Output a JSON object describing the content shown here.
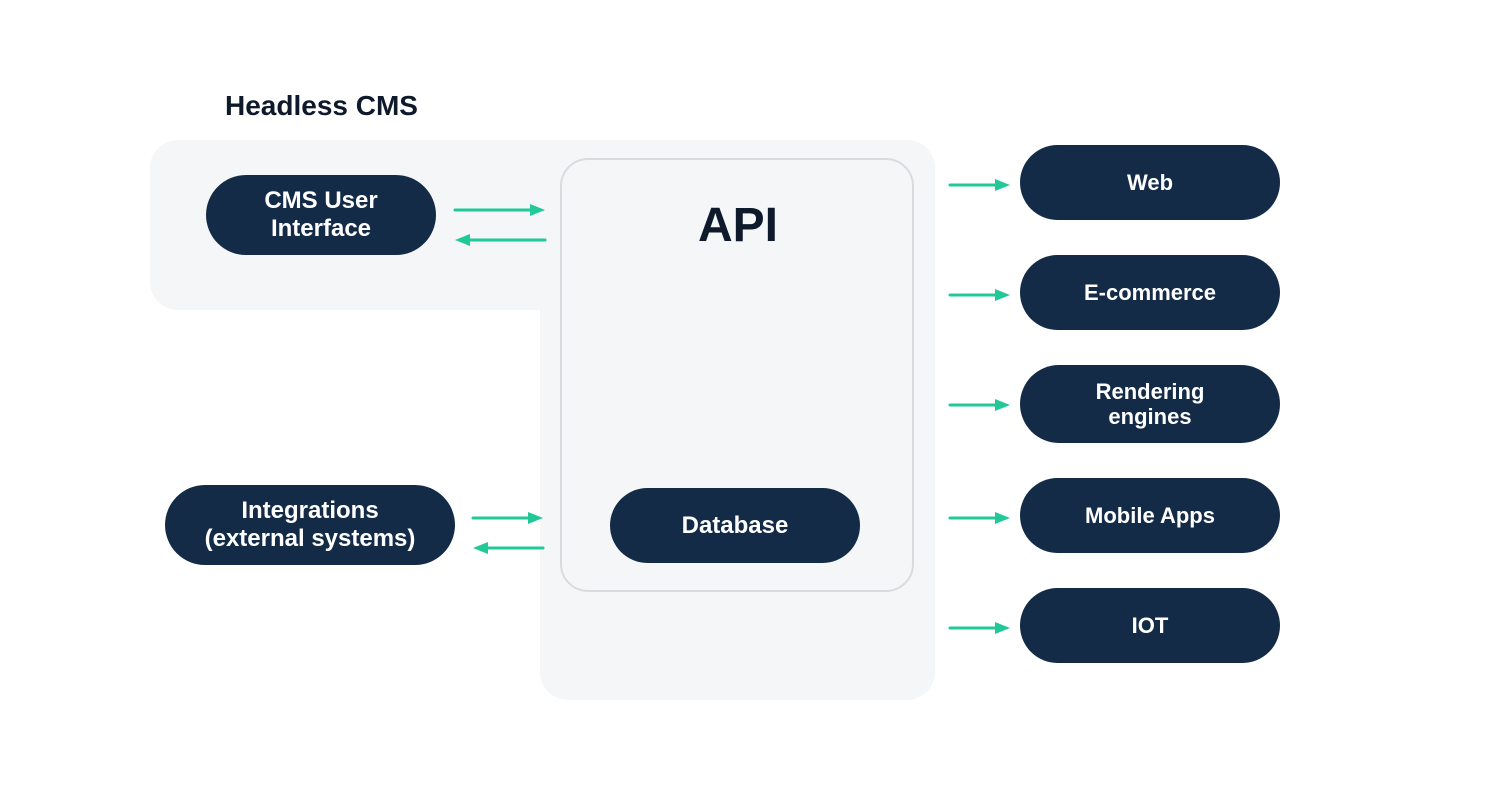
{
  "title": "Headless CMS",
  "nodes": {
    "cms_ui": "CMS User\nInterface",
    "api": "API",
    "database": "Database",
    "integrations": "Integrations\n(external systems)",
    "outputs": [
      "Web",
      "E-commerce",
      "Rendering\nengines",
      "Mobile Apps",
      "IOT"
    ]
  },
  "colors": {
    "pill_bg": "#142b47",
    "panel_bg": "#f5f6f7",
    "arrow": "#20c997",
    "text_dark": "#0e1a2b"
  }
}
